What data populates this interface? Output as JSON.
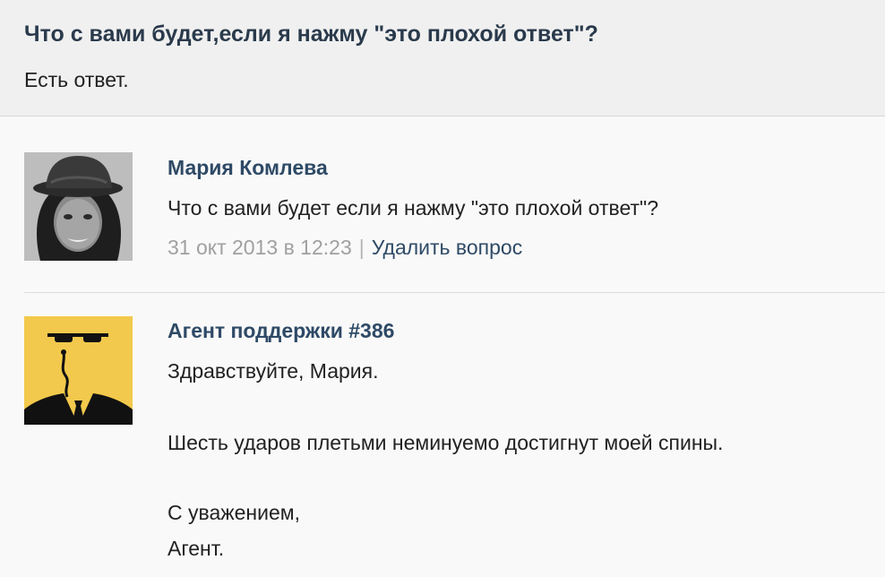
{
  "header": {
    "title": "Что с вами будет,если я нажму \"это плохой ответ\"?",
    "status": "Есть ответ."
  },
  "messages": [
    {
      "author": "Мария Комлева",
      "avatar_icon": "user-photo-avatar",
      "text": "Что с вами будет если я нажму \"это плохой ответ\"?",
      "date": "31 окт 2013 в 12:23",
      "separator": "|",
      "delete_label": "Удалить вопрос"
    },
    {
      "author": "Агент поддержки #386",
      "avatar_icon": "agent-avatar-icon",
      "avatar_bg": "#f2c94c",
      "lines": [
        "Здравствуйте, Мария.",
        "Шесть ударов плетьми неминуемо достигнут моей спины.",
        "С уважением,",
        "Агент."
      ]
    }
  ]
}
